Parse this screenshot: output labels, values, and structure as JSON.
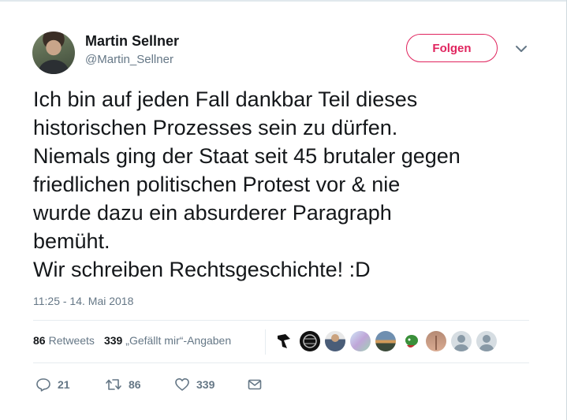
{
  "tweet": {
    "author_name": "Martin Sellner",
    "author_handle": "@Martin_Sellner",
    "follow_label": "Folgen",
    "text": "Ich bin auf jeden Fall dankbar Teil dieses\nhistorischen Prozesses sein zu dürfen.\nNiemals ging der Staat seit 45 brutaler gegen\nfriedlichen politischen Protest vor & nie\nwurde dazu ein absurderer Paragraph\nbemüht.\nWir schreiben Rechtsgeschichte! :D",
    "timestamp": "11:25 - 14. Mai 2018"
  },
  "stats": {
    "retweets_count": "86",
    "retweets_label": "Retweets",
    "likes_count": "339",
    "likes_label": "„Gefällt mir“-Angaben"
  },
  "actions": {
    "reply_count": "21",
    "retweet_count": "86",
    "like_count": "339"
  },
  "colors": {
    "follow_accent": "#e0245e",
    "muted_text": "#657786",
    "divider": "#e6ecf0"
  },
  "icons": [
    "chevron-down-icon",
    "reply-icon",
    "retweet-icon",
    "heart-icon",
    "envelope-icon"
  ]
}
